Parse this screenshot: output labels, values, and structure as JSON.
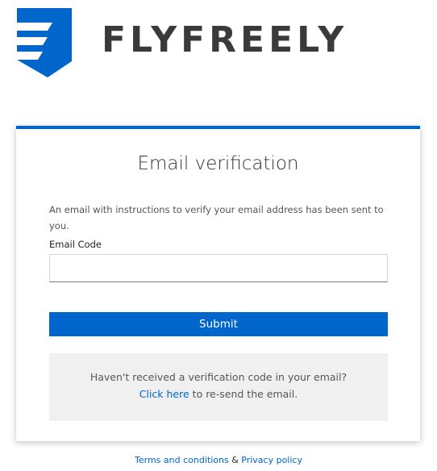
{
  "brand": {
    "name": "FLYFREELY",
    "logo_icon": "wing-shield-icon",
    "logo_color": "#0066cc"
  },
  "card": {
    "accent": "#0066cc",
    "title": "Email verification",
    "intro": "An email with instructions to verify your email address has been sent to you.",
    "field_label": "Email Code",
    "field_value": "",
    "field_placeholder": "",
    "submit_label": "Submit"
  },
  "resend": {
    "message": "Haven't received a verification code in your email?",
    "link_text": "Click here",
    "suffix": "to re-send the email."
  },
  "footer": {
    "terms": "Terms and conditions",
    "separator": "&",
    "privacy": "Privacy policy"
  }
}
